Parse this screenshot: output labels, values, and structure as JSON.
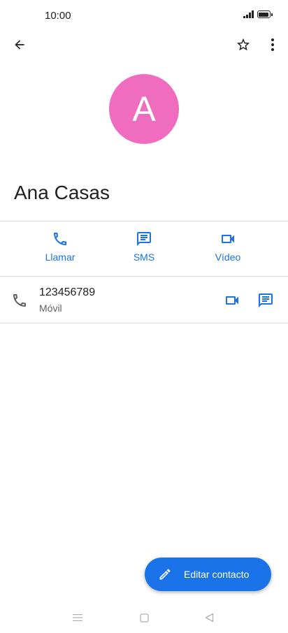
{
  "status_bar": {
    "time": "10:00",
    "icons": [
      "signal-icon",
      "battery-icon"
    ]
  },
  "toolbar": {
    "icons": [
      "back-arrow-icon",
      "star-outline-icon",
      "more-vertical-icon"
    ]
  },
  "contact": {
    "avatar_letter": "A",
    "avatar_color": "#f06cbe",
    "name": "Ana Casas"
  },
  "actions": [
    {
      "label": "Llamar",
      "icon": "phone-icon"
    },
    {
      "label": "SMS",
      "icon": "message-icon"
    },
    {
      "label": "Vídeo",
      "icon": "videocam-icon"
    }
  ],
  "phone_entry": {
    "number": "123456789",
    "type": "Móvil",
    "icons": [
      "phone-icon",
      "videocam-icon",
      "message-icon"
    ]
  },
  "fab": {
    "label": "Editar contacto",
    "icon": "pencil-icon"
  },
  "nav_bar": {
    "icons": [
      "menu-icon",
      "home-icon",
      "back-icon"
    ]
  },
  "colors": {
    "accent": "#1a73e8",
    "text": "#202124",
    "secondary_text": "#5f6368",
    "divider": "#dadce0"
  }
}
